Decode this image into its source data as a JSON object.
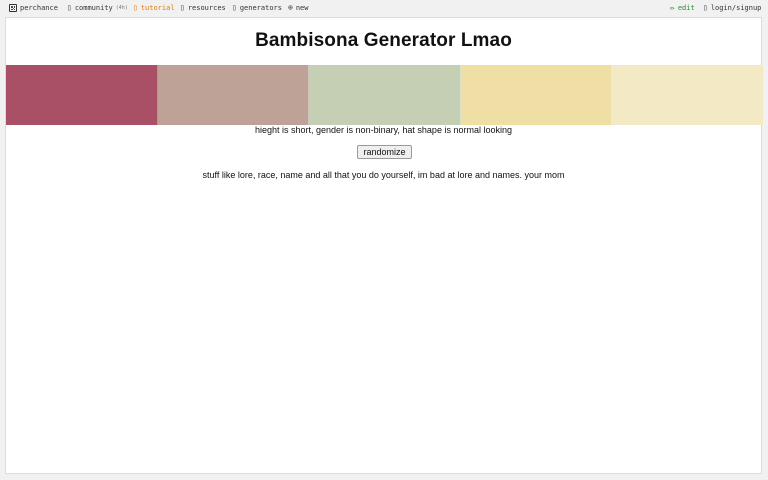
{
  "topbar": {
    "brand": "perchance",
    "community": "community",
    "community_badge": "(4h)",
    "tutorial": "tutorial",
    "resources": "resources",
    "generators": "generators",
    "new": "new",
    "edit": "edit",
    "login": "login/signup",
    "icons": {
      "brand": "dice-icon",
      "community": "chat-icon",
      "tutorial": "book-icon",
      "resources": "book-icon",
      "generators": "grid-icon",
      "new": "plus-circle-icon",
      "edit": "pencil-icon",
      "login": "user-icon"
    }
  },
  "main": {
    "title": "Bambisona Generator Lmao",
    "palette": [
      "#a94f66",
      "#bea298",
      "#c5cfb3",
      "#f0dfa5",
      "#f3e9c4"
    ],
    "description": "hieght is short, gender is non-binary, hat shape is normal looking",
    "randomize_label": "randomize",
    "note": "stuff like lore, race, name and all that you do yourself, im bad at lore and names. your mom"
  }
}
